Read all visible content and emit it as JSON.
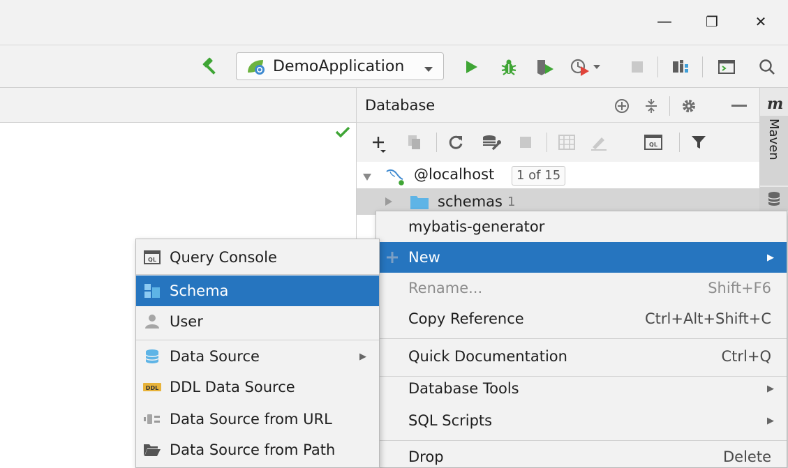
{
  "window": {
    "minimize_glyph": "—",
    "restore_glyph": "❐",
    "close_glyph": "✕"
  },
  "toolbar": {
    "run_config": "DemoApplication",
    "icons": [
      "hammer-icon",
      "run-icon",
      "debug-icon",
      "coverage-icon",
      "profile-icon",
      "stop-icon",
      "project-structure-icon",
      "terminal-icon",
      "search-icon"
    ]
  },
  "database_panel": {
    "title": "Database",
    "tree": {
      "host": "@localhost",
      "host_badge": "1 of 15",
      "schemas_label": "schemas",
      "schemas_count": "1"
    }
  },
  "right_strip": {
    "maven_icon_glyph": "m",
    "maven_label": "Maven"
  },
  "context_menu": {
    "header_item": "mybatis-generator",
    "new": "New",
    "rename": "Rename...",
    "rename_shortcut": "Shift+F6",
    "copy_reference": "Copy Reference",
    "copy_reference_shortcut": "Ctrl+Alt+Shift+C",
    "quick_documentation": "Quick Documentation",
    "quick_documentation_shortcut": "Ctrl+Q",
    "database_tools": "Database Tools",
    "sql_scripts": "SQL Scripts",
    "drop": "Drop",
    "drop_shortcut": "Delete"
  },
  "new_submenu": {
    "query_console": "Query Console",
    "schema": "Schema",
    "user": "User",
    "data_source": "Data Source",
    "ddl_data_source": "DDL Data Source",
    "data_source_from_url": "Data Source from URL",
    "data_source_from_path": "Data Source from Path",
    "ql_badge": "QL",
    "ddl_badge": "DDL"
  },
  "colors": {
    "selection": "#2675bf",
    "run_green": "#3fa535",
    "accent_blue": "#3f9fd8"
  }
}
